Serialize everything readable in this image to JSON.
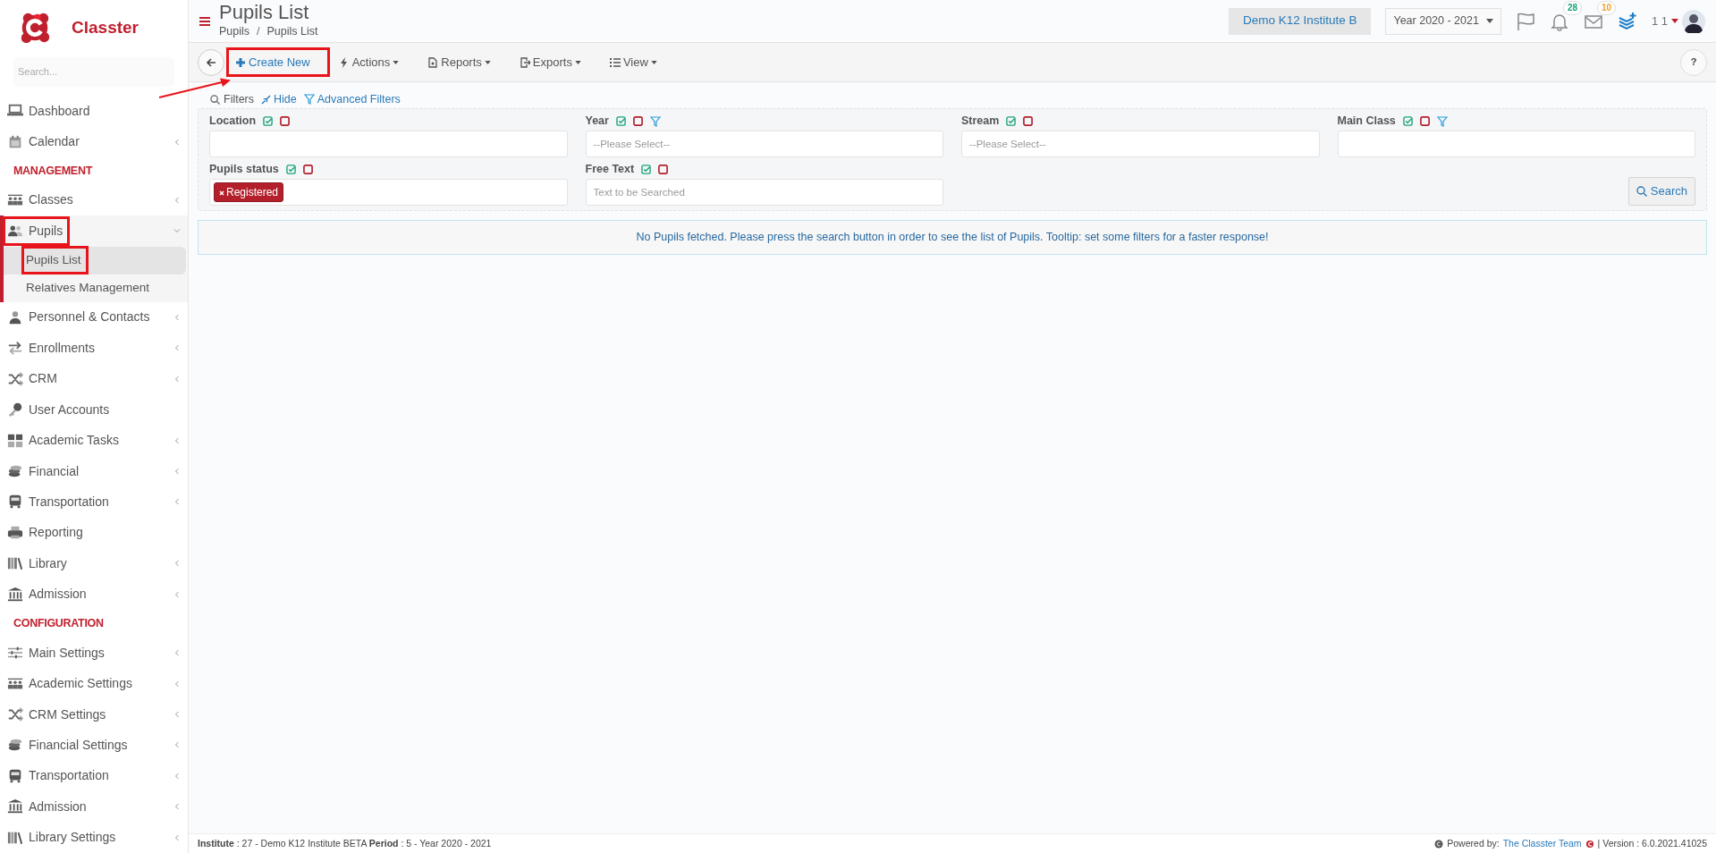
{
  "brand": {
    "name": "Classter"
  },
  "sidebar": {
    "search": {
      "placeholder": "Search..."
    },
    "items": [
      {
        "kind": "link",
        "label": "Dashboard",
        "expandable": false,
        "highlighted": false
      },
      {
        "kind": "link",
        "label": "Calendar",
        "expandable": true,
        "expanded": false,
        "highlighted": false
      },
      {
        "kind": "heading",
        "label": "MANAGEMENT"
      },
      {
        "kind": "link",
        "label": "Classes",
        "expandable": true,
        "expanded": false,
        "highlighted": false
      },
      {
        "kind": "link",
        "label": "Pupils",
        "expandable": true,
        "expanded": true,
        "highlighted": true,
        "children": [
          {
            "label": "Pupils List",
            "selected": true,
            "highlighted": true
          },
          {
            "label": "Relatives Management",
            "selected": false,
            "highlighted": false
          }
        ]
      },
      {
        "kind": "link",
        "label": "Personnel & Contacts",
        "expandable": true,
        "expanded": false,
        "highlighted": false
      },
      {
        "kind": "link",
        "label": "Enrollments",
        "expandable": true,
        "expanded": false,
        "highlighted": false
      },
      {
        "kind": "link",
        "label": "CRM",
        "expandable": true,
        "expanded": false,
        "highlighted": false
      },
      {
        "kind": "link",
        "label": "User Accounts",
        "expandable": false,
        "highlighted": false
      },
      {
        "kind": "link",
        "label": "Academic Tasks",
        "expandable": true,
        "expanded": false,
        "highlighted": false
      },
      {
        "kind": "link",
        "label": "Financial",
        "expandable": true,
        "expanded": false,
        "highlighted": false
      },
      {
        "kind": "link",
        "label": "Transportation",
        "expandable": true,
        "expanded": false,
        "highlighted": false
      },
      {
        "kind": "link",
        "label": "Reporting",
        "expandable": false,
        "highlighted": false
      },
      {
        "kind": "link",
        "label": "Library",
        "expandable": true,
        "expanded": false,
        "highlighted": false
      },
      {
        "kind": "link",
        "label": "Admission",
        "expandable": true,
        "expanded": false,
        "highlighted": false
      },
      {
        "kind": "heading",
        "label": "CONFIGURATION"
      },
      {
        "kind": "link",
        "label": "Main Settings",
        "expandable": true,
        "expanded": false,
        "highlighted": false
      },
      {
        "kind": "link",
        "label": "Academic Settings",
        "expandable": true,
        "expanded": false,
        "highlighted": false
      },
      {
        "kind": "link",
        "label": "CRM Settings",
        "expandable": true,
        "expanded": false,
        "highlighted": false
      },
      {
        "kind": "link",
        "label": "Financial Settings",
        "expandable": true,
        "expanded": false,
        "highlighted": false
      },
      {
        "kind": "link",
        "label": "Transportation",
        "expandable": true,
        "expanded": false,
        "highlighted": false
      },
      {
        "kind": "link",
        "label": "Admission",
        "expandable": true,
        "expanded": false,
        "highlighted": false
      },
      {
        "kind": "link",
        "label": "Library Settings",
        "expandable": true,
        "expanded": false,
        "highlighted": false
      }
    ]
  },
  "header": {
    "title": "Pupils List",
    "breadcrumb": [
      "Pupils",
      "Pupils List"
    ],
    "breadcrumb_separator": "/",
    "institute": "Demo K12 Institute B",
    "year": "Year 2020 - 2021",
    "notifications": "28",
    "messages": "10",
    "user": "1 1"
  },
  "toolbar": {
    "buttons": [
      {
        "kind": "create",
        "label": "Create New",
        "highlighted": true
      },
      {
        "kind": "actions",
        "label": "Actions",
        "highlighted": false
      },
      {
        "kind": "reports",
        "label": "Reports",
        "highlighted": false
      },
      {
        "kind": "exports",
        "label": "Exports",
        "highlighted": false
      },
      {
        "kind": "view",
        "label": "View",
        "highlighted": false
      }
    ],
    "help": "?"
  },
  "callout_arrow": true,
  "filters": {
    "legend": "Filters",
    "hide": "Hide",
    "advanced": "Advanced Filters",
    "search_button": "Search",
    "fields": [
      {
        "label": "Location",
        "kind": "select",
        "advanced_filter": false
      },
      {
        "label": "Year",
        "kind": "select",
        "placeholder": "--Please Select--",
        "advanced_filter": true
      },
      {
        "label": "Stream",
        "kind": "select",
        "placeholder": "--Please Select--",
        "advanced_filter": false
      },
      {
        "label": "Main Class",
        "kind": "select",
        "advanced_filter": true
      },
      {
        "label": "Pupils status",
        "kind": "tags",
        "tags": [
          "Registered"
        ],
        "advanced_filter": false
      },
      {
        "label": "Free Text",
        "kind": "text",
        "placeholder": "Text to be Searched",
        "advanced_filter": false
      }
    ]
  },
  "alert": "No Pupils fetched. Please press the search button in order to see the list of Pupils. Tooltip: set some filters for a faster response!",
  "footer": {
    "info": "**Institute** : 27 - Demo K12 Institute BETA **Period** : 5 - Year 2020 - 2021",
    "powered_by": "Powered by:",
    "team": "The Classter Team",
    "version": "| Version : 6.0.2021.41025"
  }
}
